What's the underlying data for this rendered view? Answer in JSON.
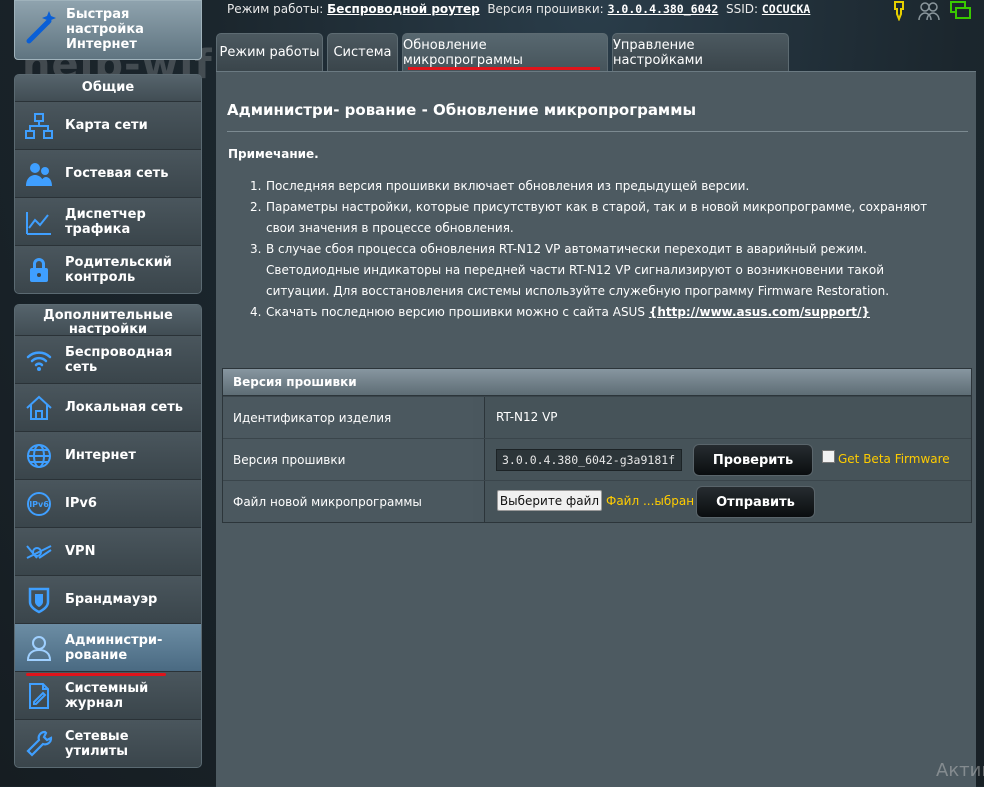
{
  "topbar": {
    "mode_label": "Режим работы:",
    "mode_value": "Беспроводной роутер",
    "firmware_label": "Версия прошивки:",
    "firmware_value": "3.0.0.4.380_6042",
    "ssid_label": "SSID:",
    "ssid_value": "COCUCKA"
  },
  "watermark": "help-wifi.ru",
  "sidebar": {
    "quick_setup": "Быстрая настройка Интернет",
    "general": {
      "title": "Общие",
      "items": [
        {
          "label": "Карта сети",
          "icon": "network-map-icon"
        },
        {
          "label": "Гостевая сеть",
          "icon": "guest-network-icon"
        },
        {
          "label": "Диспетчер трафика",
          "icon": "traffic-manager-icon"
        },
        {
          "label": "Родительский контроль",
          "icon": "parental-control-icon"
        }
      ]
    },
    "advanced": {
      "title": "Дополнительные настройки",
      "items": [
        {
          "label": "Беспроводная сеть",
          "icon": "wireless-icon"
        },
        {
          "label": "Локальная сеть",
          "icon": "lan-icon"
        },
        {
          "label": "Интернет",
          "icon": "globe-icon"
        },
        {
          "label": "IPv6",
          "icon": "ipv6-icon"
        },
        {
          "label": "VPN",
          "icon": "vpn-icon"
        },
        {
          "label": "Брандмауэр",
          "icon": "firewall-icon"
        },
        {
          "label": "Администри- рование",
          "icon": "admin-icon",
          "active": true
        },
        {
          "label": "Системный журнал",
          "icon": "system-log-icon"
        },
        {
          "label": "Сетевые утилиты",
          "icon": "network-tools-icon"
        }
      ]
    }
  },
  "tabs": [
    {
      "label": "Режим работы"
    },
    {
      "label": "Система"
    },
    {
      "label": "Обновление микропрограммы",
      "active": true
    },
    {
      "label": "Управление настройками"
    }
  ],
  "main": {
    "title": "Администри- рование - Обновление микропрограммы",
    "note_label": "Примечание.",
    "notes": [
      {
        "num": "1.",
        "text": "Последняя версия прошивки включает обновления из предыдущей версии."
      },
      {
        "num": "2.",
        "text": "Параметры настройки, которые присутствуют как в старой, так и в новой микропрограмме, сохраняют свои значения в процессе обновления."
      },
      {
        "num": "3.",
        "text": "В случае сбоя процесса обновления RT-N12 VP автоматически переходит в аварийный режим. Светодиодные индикаторы на передней части RT-N12 VP сигнализируют о возникновении такой ситуации. Для восстановления системы используйте служебную программу Firmware Restoration."
      },
      {
        "num": "4.",
        "text": "Скачать последнюю версию прошивки можно с сайта ASUS ",
        "link": "{http://www.asus.com/support/}"
      }
    ],
    "table": {
      "header": "Версия прошивки",
      "product_id_label": "Идентификатор изделия",
      "product_id_value": "RT-N12 VP",
      "fw_version_label": "Версия прошивки",
      "fw_version_value": "3.0.0.4.380_6042-g3a9181f",
      "check_button": "Проверить",
      "beta_label": "Get Beta Firmware",
      "new_fw_label": "Файл новой микропрограммы",
      "choose_file_button": "Выберите файл",
      "file_status": "Файл ...ыбран",
      "upload_button": "Отправить"
    }
  },
  "os_watermark": "Актив",
  "colors": {
    "accent_red": "#e0141b",
    "highlight_yellow": "#ffcc00",
    "panel": "#4d5a61"
  }
}
